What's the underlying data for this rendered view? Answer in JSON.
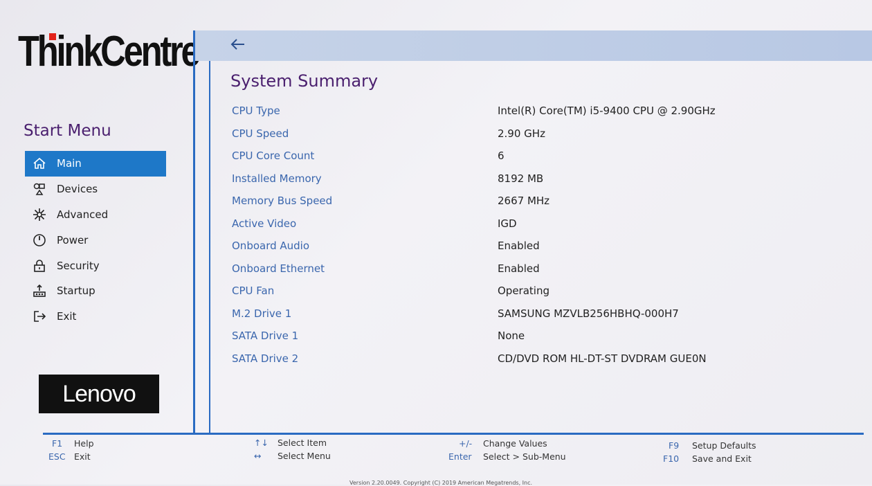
{
  "brand": {
    "name": "ThinkCentre",
    "logo": "Lenovo"
  },
  "sidebar": {
    "title": "Start Menu",
    "items": [
      {
        "label": "Main",
        "icon": "home-icon",
        "active": true
      },
      {
        "label": "Devices",
        "icon": "devices-icon"
      },
      {
        "label": "Advanced",
        "icon": "advanced-icon"
      },
      {
        "label": "Power",
        "icon": "power-icon"
      },
      {
        "label": "Security",
        "icon": "lock-icon"
      },
      {
        "label": "Startup",
        "icon": "startup-icon"
      },
      {
        "label": "Exit",
        "icon": "exit-icon"
      }
    ]
  },
  "main": {
    "title": "System Summary",
    "rows": [
      {
        "label": "CPU Type",
        "value": "Intel(R) Core(TM) i5-9400 CPU @ 2.90GHz"
      },
      {
        "label": "CPU Speed",
        "value": "2.90 GHz"
      },
      {
        "label": "CPU Core Count",
        "value": "6"
      },
      {
        "label": "Installed Memory",
        "value": "8192 MB"
      },
      {
        "label": "Memory Bus Speed",
        "value": "2667 MHz"
      },
      {
        "label": "Active Video",
        "value": "IGD"
      },
      {
        "label": "Onboard Audio",
        "value": "Enabled"
      },
      {
        "label": "Onboard Ethernet",
        "value": "Enabled"
      },
      {
        "label": "CPU Fan",
        "value": "Operating"
      },
      {
        "label": "M.2 Drive 1",
        "value": "SAMSUNG MZVLB256HBHQ-000H7"
      },
      {
        "label": "SATA Drive 1",
        "value": "None"
      },
      {
        "label": "SATA Drive 2",
        "value": "CD/DVD ROM HL-DT-ST DVDRAM GUE0N"
      }
    ]
  },
  "footer": {
    "hints": [
      {
        "key": "F1",
        "text": "Help"
      },
      {
        "key": "ESC",
        "text": "Exit"
      },
      {
        "key": "↑↓",
        "text": "Select Item"
      },
      {
        "key": "↔",
        "text": "Select Menu"
      },
      {
        "key": "+/-",
        "text": "Change Values"
      },
      {
        "key": "Enter",
        "text": "Select > Sub-Menu"
      },
      {
        "key": "F9",
        "text": "Setup Defaults"
      },
      {
        "key": "F10",
        "text": "Save and Exit"
      }
    ],
    "copyright": "Version 2.20.0049. Copyright (C) 2019 American Megatrends, Inc."
  },
  "colors": {
    "accent": "#1e78c8",
    "label": "#3a66ad",
    "title": "#4a1f6e",
    "line": "#2a6bc2"
  }
}
